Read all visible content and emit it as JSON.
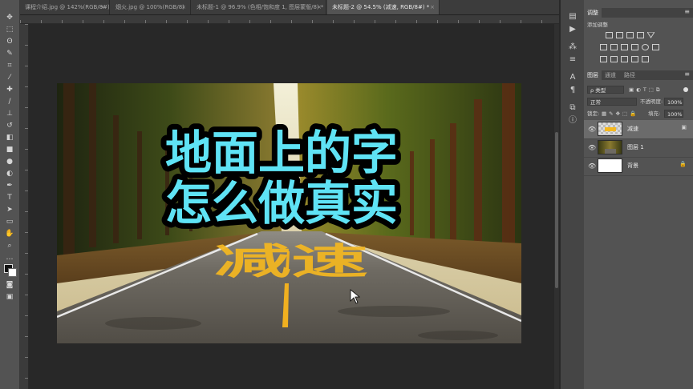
{
  "tabs": [
    {
      "label": "课程介绍.jpg @ 142%(RGB/8#)",
      "active": false
    },
    {
      "label": "烟火.jpg @ 100%(RGB/8)",
      "active": false
    },
    {
      "label": "未标题-1 @ 96.9% (色相/饱和度 1, 图层蒙版/8) *",
      "active": false
    },
    {
      "label": "未标题-2 @ 54.5% (减速, RGB/8#) *",
      "active": true
    }
  ],
  "tab_close": "×",
  "canvas": {
    "headline_line1": "地面上的字",
    "headline_line2": "怎么做真实",
    "road_text": "减速",
    "headline_color": "#5fe3f5",
    "road_text_color": "#f5b820"
  },
  "adjustments": {
    "title": "调整",
    "add_label": "添加调整"
  },
  "layers_panel": {
    "tabs": [
      "图层",
      "通道",
      "路径"
    ],
    "filter_label": "ρ 类型",
    "blend_mode": "正常",
    "opacity_label": "不透明度:",
    "opacity_value": "100%",
    "lock_label": "锁定:",
    "fill_label": "填充:",
    "fill_value": "100%",
    "layers": [
      {
        "name": "减速",
        "selected": true
      },
      {
        "name": "图层 1",
        "selected": false
      },
      {
        "name": "背景",
        "selected": false
      }
    ]
  }
}
